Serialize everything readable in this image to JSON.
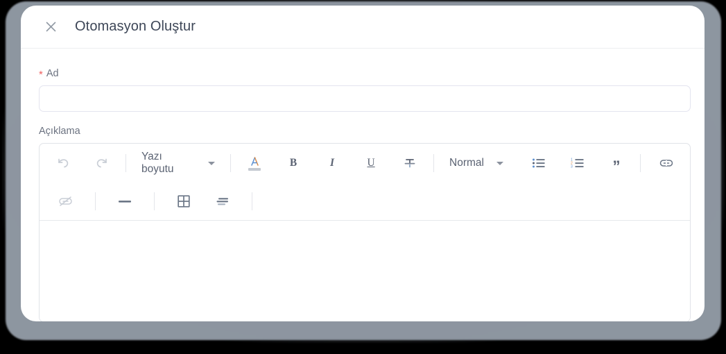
{
  "dialog": {
    "title": "Otomasyon Oluştur",
    "close_icon": "close-x-icon"
  },
  "form": {
    "name": {
      "label": "Ad",
      "required_marker": "*",
      "value": "",
      "placeholder": ""
    },
    "description": {
      "label": "Açıklama",
      "value": "",
      "placeholder": ""
    }
  },
  "editor_toolbar": {
    "row1": [
      {
        "name": "undo-icon",
        "label": "",
        "disabled": true
      },
      {
        "name": "redo-icon",
        "label": "",
        "disabled": true
      },
      {
        "name": "font-size-select",
        "label": "Yazı boyutu"
      },
      {
        "name": "text-color-icon",
        "label": "A"
      },
      {
        "name": "bold-icon",
        "label": "B"
      },
      {
        "name": "italic-icon",
        "label": "I"
      },
      {
        "name": "underline-icon",
        "label": "U"
      },
      {
        "name": "strikethrough-icon",
        "label": ""
      },
      {
        "name": "paragraph-style-select",
        "label": "Normal"
      },
      {
        "name": "bulleted-list-icon",
        "label": ""
      },
      {
        "name": "numbered-list-icon",
        "label": ""
      },
      {
        "name": "blockquote-icon",
        "label": "”"
      },
      {
        "name": "link-icon",
        "label": ""
      }
    ],
    "row2": [
      {
        "name": "unlink-icon",
        "label": "",
        "disabled": true
      },
      {
        "name": "horizontal-rule-icon",
        "label": ""
      },
      {
        "name": "table-icon",
        "label": ""
      },
      {
        "name": "align-left-icon",
        "label": ""
      }
    ],
    "font_size_label": "Yazı boyutu",
    "paragraph_style_label": "Normal",
    "text_color_glyph": "A",
    "bold_glyph": "B",
    "italic_glyph": "I",
    "underline_glyph": "U",
    "quote_glyph": "”"
  },
  "colors": {
    "dialog_bg": "#ffffff",
    "backdrop": "#000000",
    "shadow": "#9aa3ae",
    "title_text": "#3d4657",
    "label_text": "#6b7280",
    "required_red": "#f06060",
    "input_border": "#e3e4ef",
    "icon": "#5b6373",
    "icon_disabled": "#c9ced6"
  }
}
